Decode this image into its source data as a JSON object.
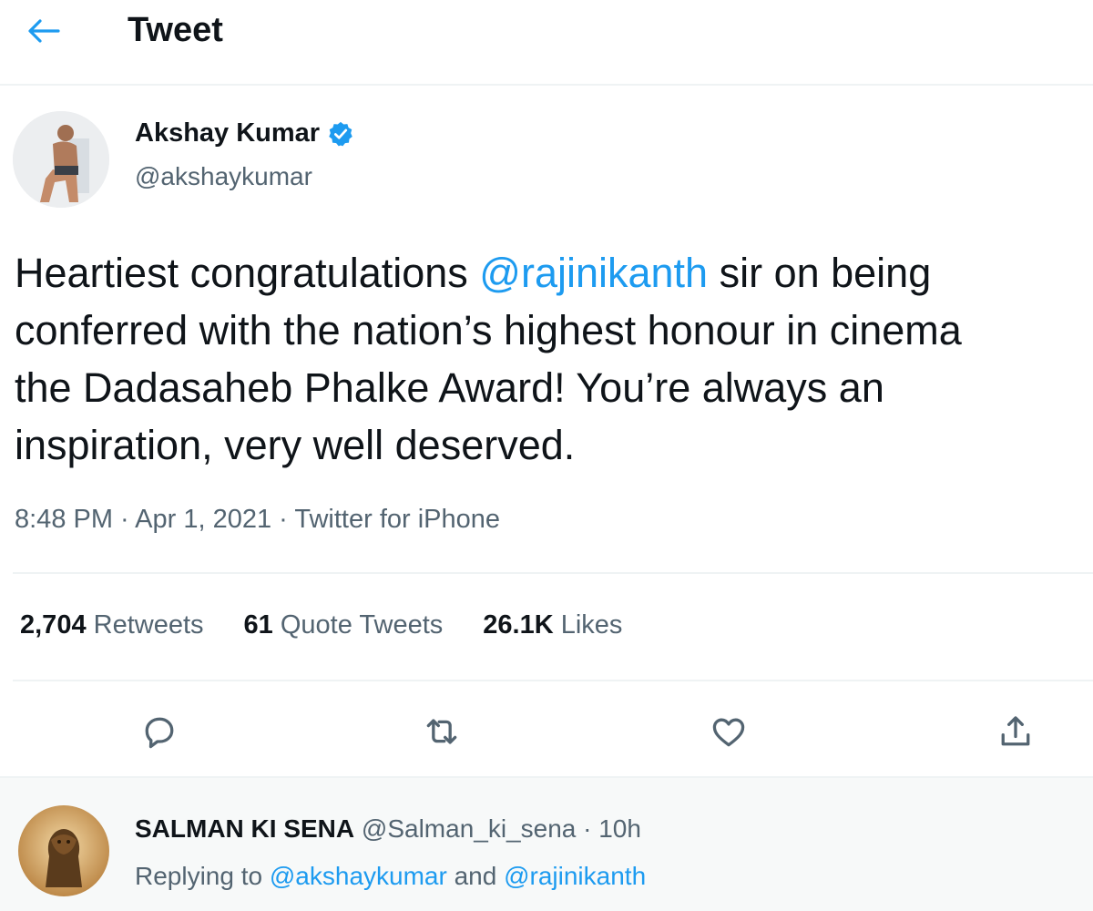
{
  "header": {
    "title": "Tweet",
    "back_icon": "arrow-left-icon"
  },
  "author": {
    "name": "Akshay Kumar",
    "handle": "@akshaykumar",
    "verified": true
  },
  "tweet": {
    "text_1": "Heartiest congratulations ",
    "mention_1": "@rajinikanth",
    "text_2": " sir on being\nconferred with the nation’s highest honour in cinema\nthe Dadasaheb Phalke Award! You’re always an\ninspiration, very well deserved.",
    "meta": "8:48 PM · Apr 1, 2021 · Twitter for iPhone"
  },
  "stats": {
    "retweets_count": "2,704",
    "retweets_label": "Retweets",
    "quotes_count": "61",
    "quotes_label": "Quote Tweets",
    "likes_count": "26.1K",
    "likes_label": "Likes"
  },
  "actions": [
    "reply-icon",
    "retweet-icon",
    "like-icon",
    "share-icon"
  ],
  "reply": {
    "name": "SALMAN KI SENA",
    "handle_time": "@Salman_ki_sena · 10h",
    "replying_prefix": "Replying to ",
    "mention_a": "@akshaykumar",
    "and_text": " and ",
    "mention_b": "@rajinikanth"
  },
  "colors": {
    "accent": "#1d9bf0",
    "text": "#0f1419",
    "muted": "#536471",
    "border": "#eff3f4"
  }
}
